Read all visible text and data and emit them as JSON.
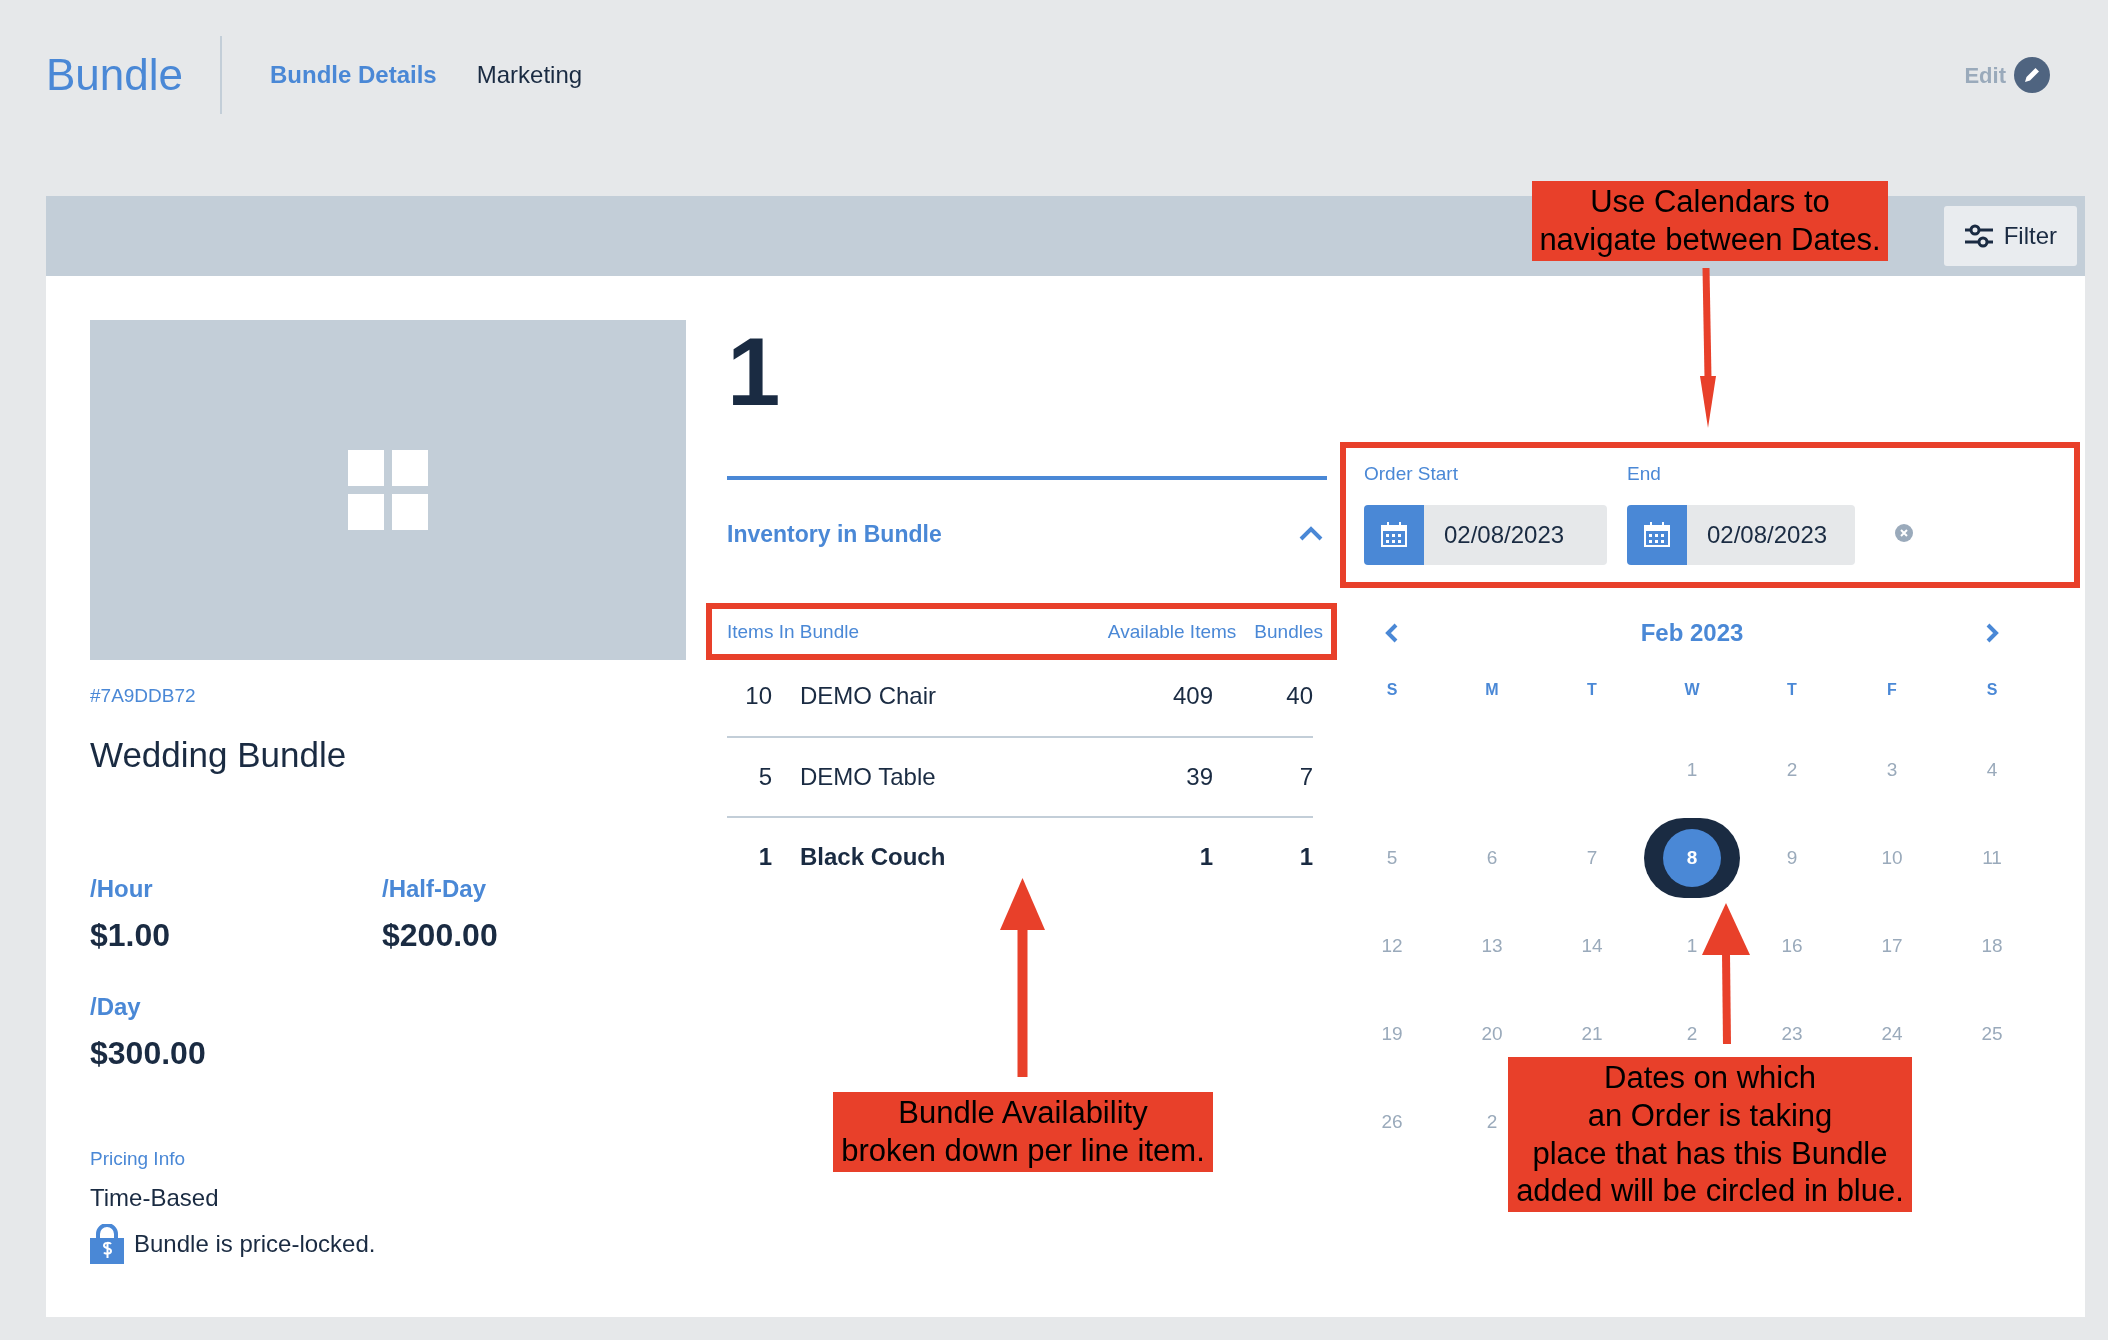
{
  "header": {
    "title": "Bundle",
    "tabs": [
      {
        "label": "Bundle Details",
        "selected": true
      },
      {
        "label": "Marketing",
        "selected": false
      }
    ],
    "edit": "Edit"
  },
  "toolbar": {
    "filter": "Filter"
  },
  "bundle": {
    "sku": "#7A9DDB72",
    "name": "Wedding Bundle",
    "prices": [
      {
        "label": "/Hour",
        "value": "$1.00"
      },
      {
        "label": "/Half-Day",
        "value": "$200.00"
      },
      {
        "label": "/Day",
        "value": "$300.00"
      }
    ],
    "pricing_info_label": "Pricing Info",
    "pricing_info": "Time-Based",
    "lock_note": "Bundle is price-locked."
  },
  "count": "1",
  "inventory": {
    "title": "Inventory in Bundle",
    "expanded": true,
    "columns": [
      "Items In Bundle",
      "Available Items",
      "Bundles"
    ],
    "rows": [
      {
        "qty": "10",
        "name": "DEMO Chair",
        "available": "409",
        "bundles": "40",
        "emphasized": false
      },
      {
        "qty": "5",
        "name": "DEMO Table",
        "available": "39",
        "bundles": "7",
        "emphasized": false
      },
      {
        "qty": "1",
        "name": "Black Couch",
        "available": "1",
        "bundles": "1",
        "emphasized": true
      }
    ]
  },
  "dates": {
    "start": {
      "label": "Order Start",
      "value": "02/08/2023"
    },
    "end": {
      "label": "End",
      "value": "02/08/2023"
    }
  },
  "calendar": {
    "month": "Feb 2023",
    "weekdays": [
      "S",
      "M",
      "T",
      "W",
      "T",
      "F",
      "S"
    ],
    "weeks": [
      [
        {
          "day": "1",
          "marked": false
        },
        {
          "day": "2",
          "marked": false
        },
        {
          "day": "3",
          "marked": false
        },
        {
          "day": "4",
          "marked": false
        }
      ],
      [
        {
          "day": "5",
          "marked": false
        },
        {
          "day": "6",
          "marked": false
        },
        {
          "day": "7",
          "marked": false
        },
        {
          "day": "8",
          "marked": true
        },
        {
          "day": "9",
          "marked": false
        },
        {
          "day": "10",
          "marked": false
        },
        {
          "day": "11",
          "marked": false
        }
      ],
      [
        {
          "day": "12",
          "marked": false
        },
        {
          "day": "13",
          "marked": false
        },
        {
          "day": "14",
          "marked": false
        },
        {
          "day": "1",
          "marked": false
        },
        {
          "day": "16",
          "marked": false
        },
        {
          "day": "17",
          "marked": false
        },
        {
          "day": "18",
          "marked": false
        }
      ],
      [
        {
          "day": "19",
          "marked": false
        },
        {
          "day": "20",
          "marked": false
        },
        {
          "day": "21",
          "marked": false
        },
        {
          "day": "2",
          "marked": false
        },
        {
          "day": "23",
          "marked": false
        },
        {
          "day": "24",
          "marked": false
        },
        {
          "day": "25",
          "marked": false
        }
      ],
      [
        {
          "day": "26",
          "marked": false
        },
        {
          "day": "2",
          "marked": false
        }
      ]
    ]
  },
  "annotations": [
    {
      "lines": [
        "Use Calendars to",
        "navigate between Dates."
      ]
    },
    {
      "lines": [
        "Bundle Availability",
        "broken down per line item."
      ]
    },
    {
      "lines": [
        "Dates on which",
        "an Order is taking",
        "place that has this Bundle",
        "added will be circled in blue."
      ]
    }
  ]
}
